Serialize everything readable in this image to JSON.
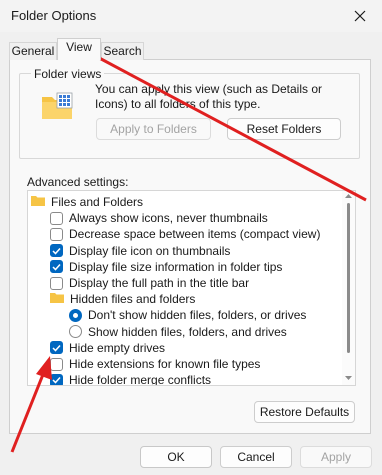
{
  "window": {
    "title": "Folder Options",
    "close_glyph": "✕"
  },
  "tabs": [
    {
      "label": "General",
      "active": false
    },
    {
      "label": "View",
      "active": true
    },
    {
      "label": "Search",
      "active": false
    }
  ],
  "folder_views": {
    "label": "Folder views",
    "description": "You can apply this view (such as Details or Icons) to all folders of this type.",
    "apply_button": "Apply to Folders",
    "reset_button": "Reset Folders"
  },
  "advanced": {
    "label": "Advanced settings:",
    "items": [
      {
        "type": "folder",
        "label": "Files and Folders",
        "indent": 0
      },
      {
        "type": "checkbox",
        "label": "Always show icons, never thumbnails",
        "checked": false,
        "indent": 1
      },
      {
        "type": "checkbox",
        "label": "Decrease space between items (compact view)",
        "checked": false,
        "indent": 1
      },
      {
        "type": "checkbox",
        "label": "Display file icon on thumbnails",
        "checked": true,
        "indent": 1
      },
      {
        "type": "checkbox",
        "label": "Display file size information in folder tips",
        "checked": true,
        "indent": 1
      },
      {
        "type": "checkbox",
        "label": "Display the full path in the title bar",
        "checked": false,
        "indent": 1
      },
      {
        "type": "folder",
        "label": "Hidden files and folders",
        "indent": 1
      },
      {
        "type": "radio",
        "label": "Don't show hidden files, folders, or drives",
        "checked": true,
        "indent": 2
      },
      {
        "type": "radio",
        "label": "Show hidden files, folders, and drives",
        "checked": false,
        "indent": 2
      },
      {
        "type": "checkbox",
        "label": "Hide empty drives",
        "checked": true,
        "indent": 1
      },
      {
        "type": "checkbox",
        "label": "Hide extensions for known file types",
        "checked": false,
        "indent": 1
      },
      {
        "type": "checkbox",
        "label": "Hide folder merge conflicts",
        "checked": true,
        "indent": 1
      }
    ]
  },
  "restore_button": "Restore Defaults",
  "footer": {
    "ok": "OK",
    "cancel": "Cancel",
    "apply": "Apply"
  },
  "colors": {
    "accent": "#0067c0",
    "annotation_arrow": "#e02020",
    "folder": "#f6c445"
  }
}
